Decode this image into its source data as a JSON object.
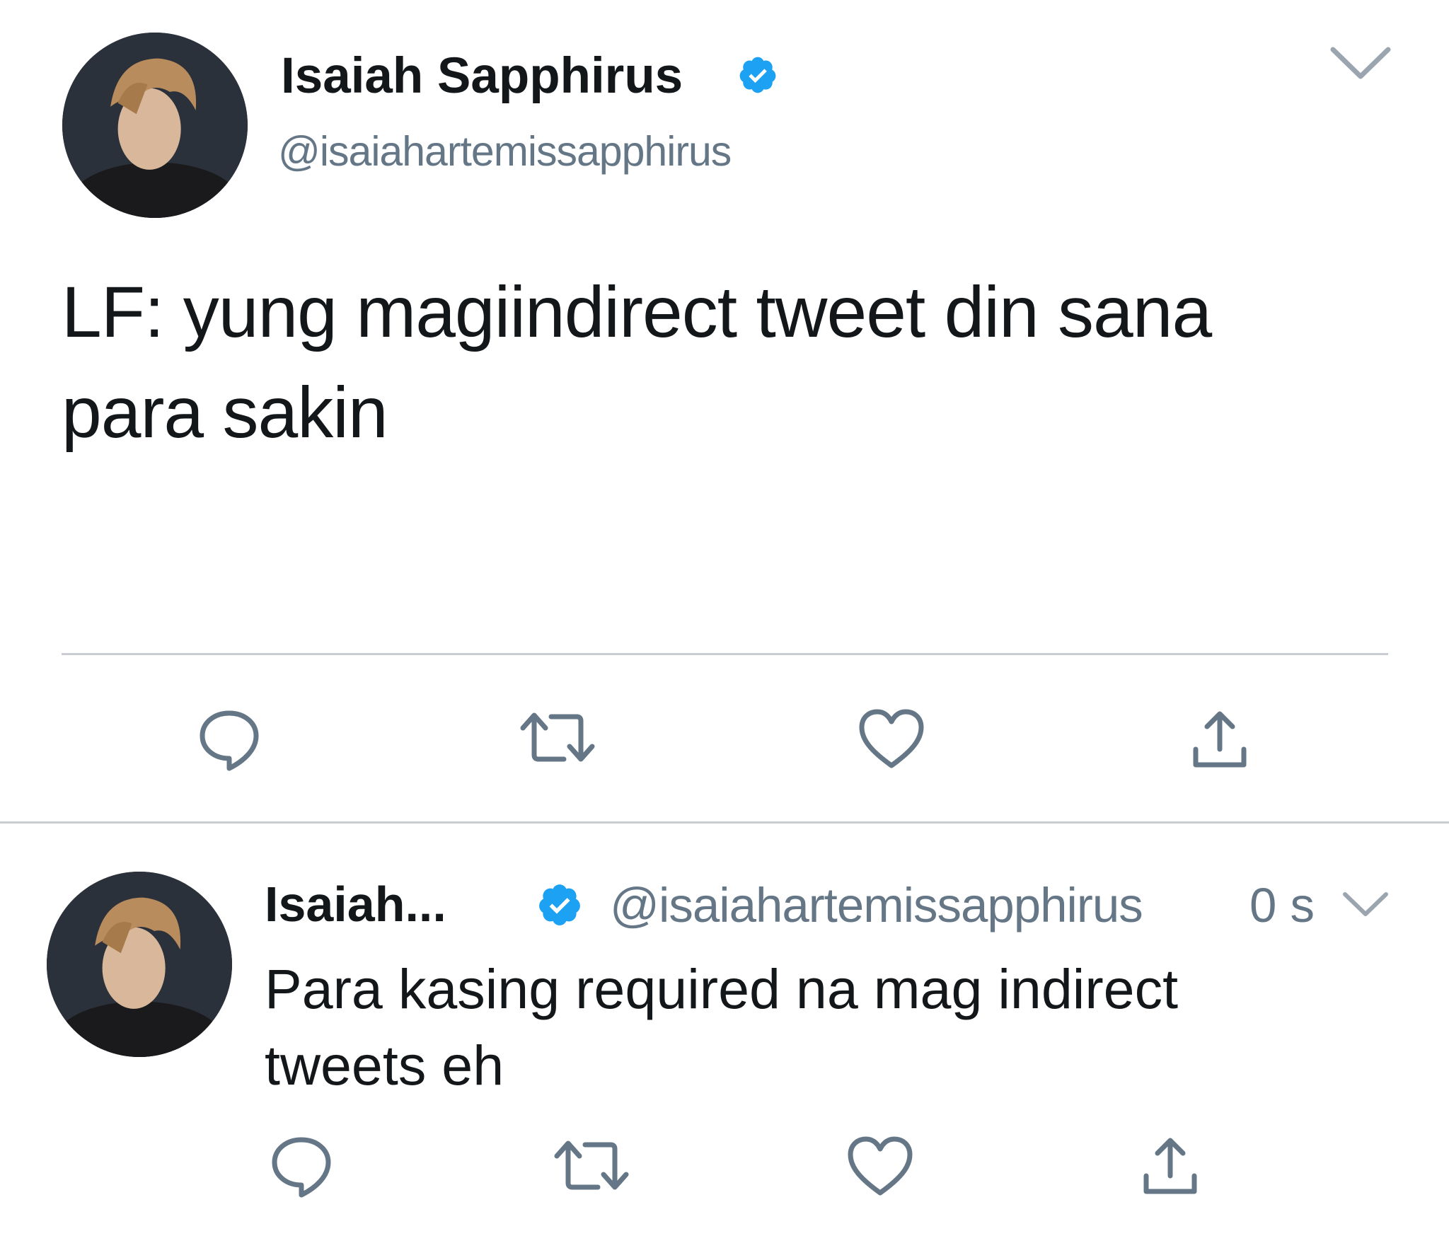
{
  "main_tweet": {
    "display_name": "Isaiah Sapphirus",
    "handle": "@isaiahartemissapphirus",
    "text_line1": "LF: yung magiindirect tweet din sana",
    "text_line2": "para sakin",
    "icons": [
      "reply-icon",
      "retweet-icon",
      "like-icon",
      "share-icon"
    ]
  },
  "reply_tweet": {
    "display_name": "Isaiah...",
    "handle": "@isaiahartemissapphirus",
    "timestamp": "0 s",
    "text_line1": "Para kasing required na mag indirect",
    "text_line2": "tweets eh",
    "icons": [
      "reply-icon",
      "retweet-icon",
      "like-icon",
      "share-icon"
    ]
  },
  "colors": {
    "verified_blue": "#1da1f2",
    "icon_gray": "#657786",
    "text": "#14171a",
    "divider": "#c9cdd1"
  }
}
